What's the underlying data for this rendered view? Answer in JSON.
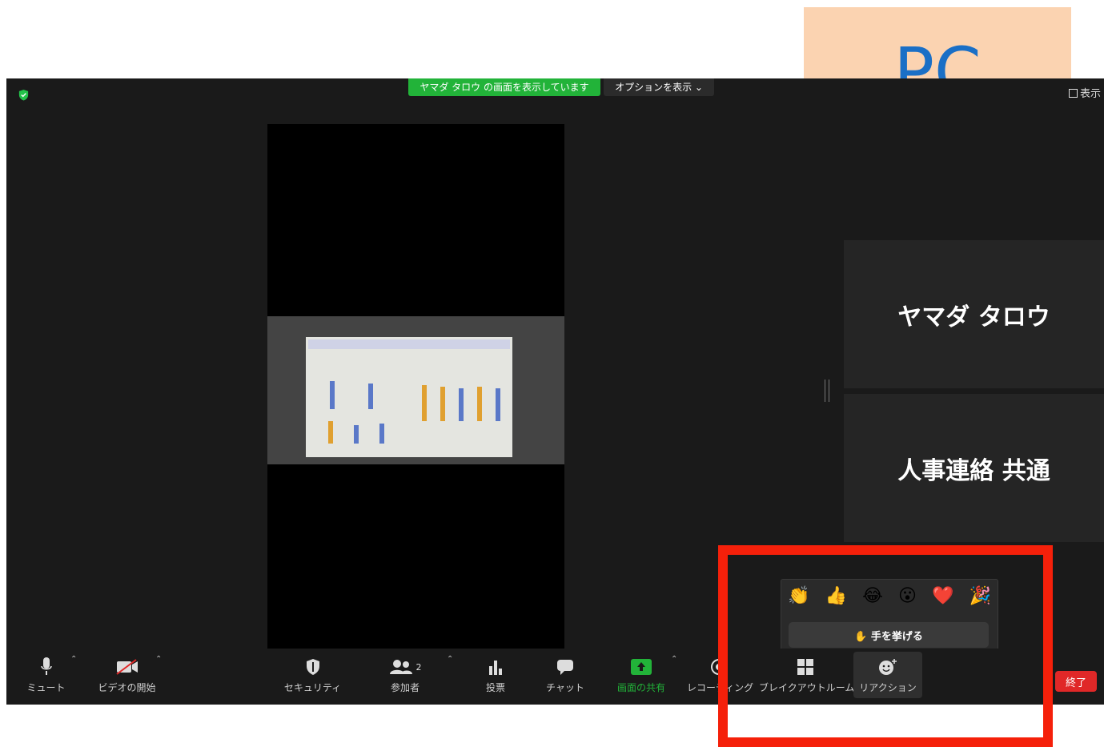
{
  "header": {
    "sharing_banner": "ヤマダ タロウ の画面を表示しています",
    "options_label": "オプションを表示 ⌄",
    "view_label": "表示"
  },
  "participants": [
    {
      "name": "ヤマダ タロウ"
    },
    {
      "name": "人事連絡 共通"
    }
  ],
  "callout": {
    "text": "PC"
  },
  "reactions": {
    "emojis": [
      "👏",
      "👍",
      "😂",
      "😮",
      "❤️",
      "🎉"
    ],
    "raise_hand": "✋ 手を挙げる"
  },
  "toolbar": {
    "mute": "ミュート",
    "video": "ビデオの開始",
    "security": "セキュリティ",
    "participants": "参加者",
    "participants_count": "2",
    "poll": "投票",
    "chat": "チャット",
    "share": "画面の共有",
    "recording": "レコーディング",
    "breakout": "ブレイクアウトルーム",
    "reaction": "リアクション",
    "end": "終了"
  },
  "colors": {
    "accent_green": "#22b339",
    "end_red": "#e02828",
    "highlight_red": "#f5200a",
    "callout_bg": "#fbd3b1",
    "callout_text": "#1a6fc6"
  }
}
